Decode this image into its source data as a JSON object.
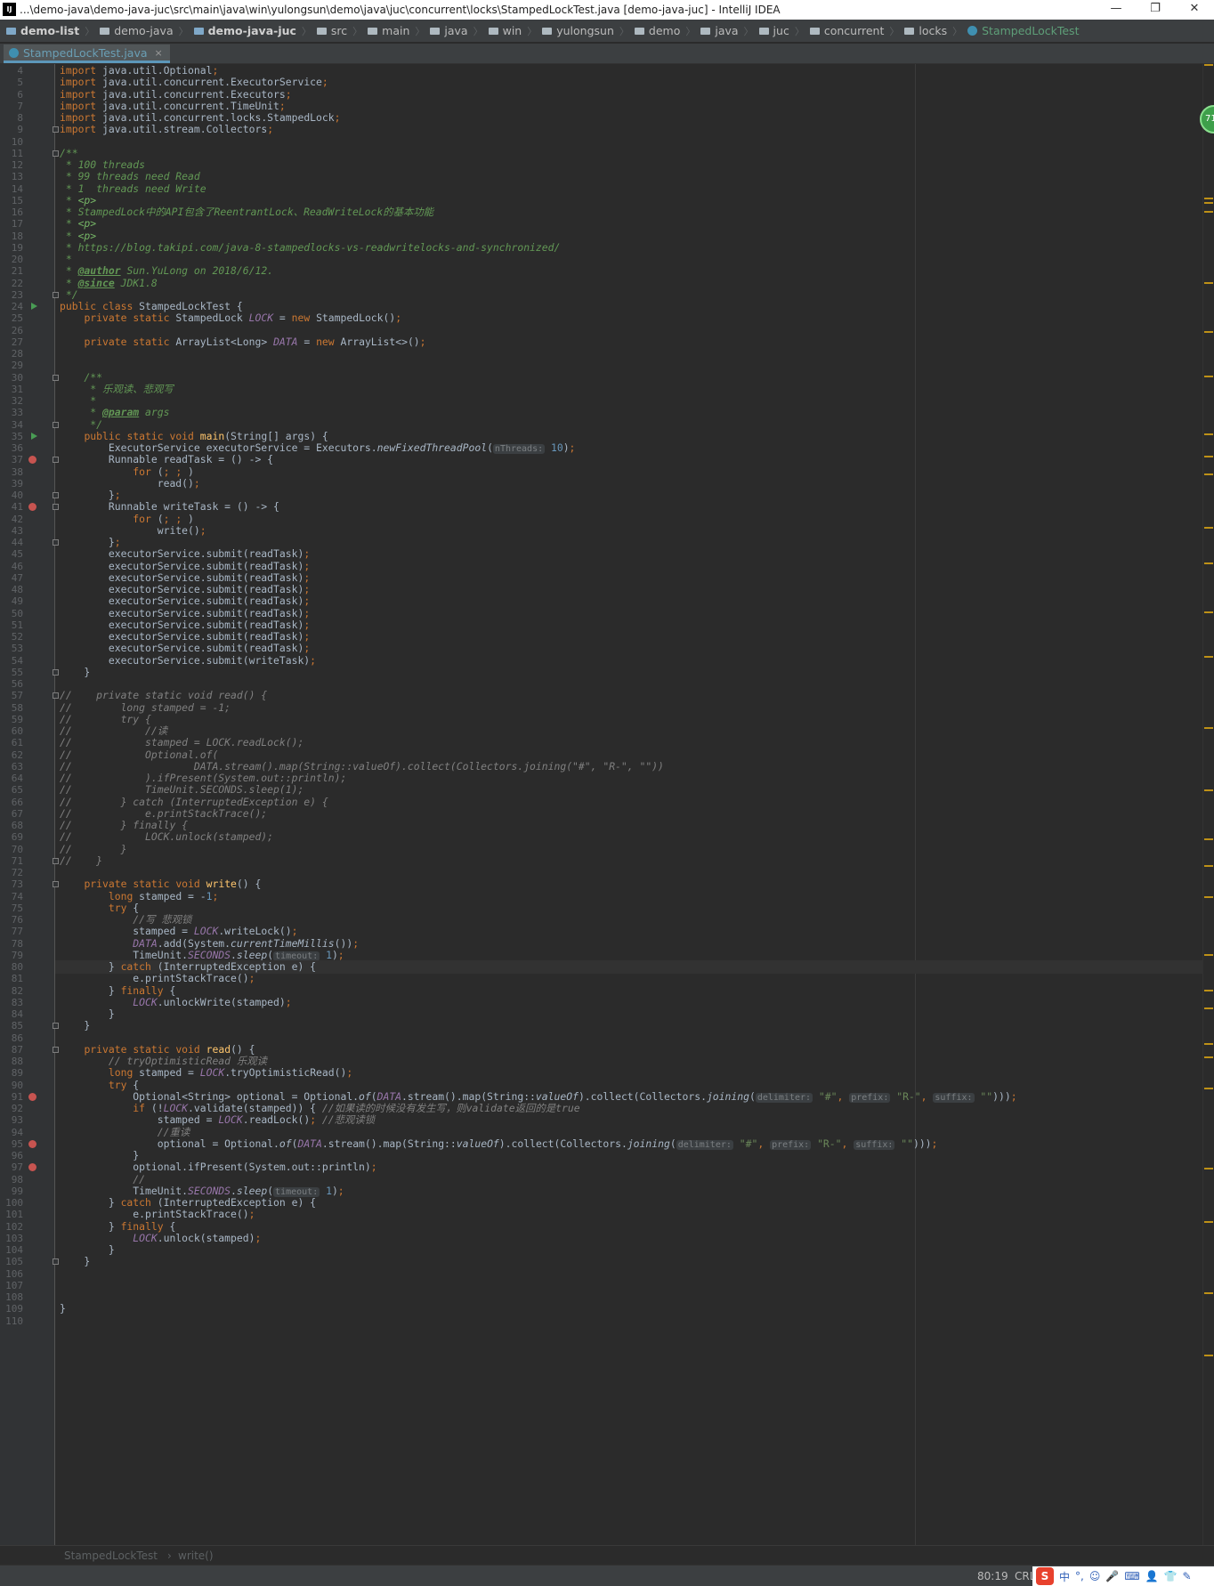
{
  "window": {
    "title": "...\\demo-java\\demo-java-juc\\src\\main\\java\\win\\yulongsun\\demo\\java\\juc\\concurrent\\locks\\StampedLockTest.java [demo-java-juc] - IntelliJ IDEA",
    "logo": "IJ",
    "minimize": "—",
    "restore": "❐",
    "close": "✕"
  },
  "breadcrumbs": [
    {
      "label": "demo-list",
      "bold": true,
      "icon": "module-folder-icon"
    },
    {
      "label": "demo-java",
      "icon": "folder-icon"
    },
    {
      "label": "demo-java-juc",
      "bold": true,
      "icon": "module-folder-icon"
    },
    {
      "label": "src",
      "icon": "folder-icon"
    },
    {
      "label": "main",
      "icon": "folder-icon"
    },
    {
      "label": "java",
      "icon": "folder-icon"
    },
    {
      "label": "win",
      "icon": "folder-icon"
    },
    {
      "label": "yulongsun",
      "icon": "folder-icon"
    },
    {
      "label": "demo",
      "icon": "folder-icon"
    },
    {
      "label": "java",
      "icon": "folder-icon"
    },
    {
      "label": "juc",
      "icon": "folder-icon"
    },
    {
      "label": "concurrent",
      "icon": "folder-icon"
    },
    {
      "label": "locks",
      "icon": "folder-icon"
    },
    {
      "label": "StampedLockTest",
      "cls": true,
      "icon": "class-icon"
    }
  ],
  "tab": {
    "label": "StampedLockTest.java",
    "close": "×"
  },
  "code_lines": [
    "import java.util.Optional;",
    "import java.util.concurrent.ExecutorService;",
    "import java.util.concurrent.Executors;",
    "import java.util.concurrent.TimeUnit;",
    "import java.util.concurrent.locks.StampedLock;",
    "import java.util.stream.Collectors;",
    "",
    "/**",
    " * 100 threads",
    " * 99 threads need Read",
    " * 1  threads need Write",
    " * <p>",
    " * StampedLock中的API包含了ReentrantLock、ReadWriteLock的基本功能",
    " * <p>",
    " * <p>",
    " * https://blog.takipi.com/java-8-stampedlocks-vs-readwritelocks-and-synchronized/",
    " *",
    " * @author Sun.YuLong on 2018/6/12.",
    " * @since JDK1.8",
    " */",
    "public class StampedLockTest {",
    "    private static StampedLock LOCK = new StampedLock();",
    "",
    "    private static ArrayList<Long> DATA = new ArrayList<>();",
    "",
    "",
    "    /**",
    "     * 乐观读、悲观写",
    "     *",
    "     * @param args",
    "     */",
    "    public static void main(String[] args) {",
    "        ExecutorService executorService = Executors.newFixedThreadPool(nThreads: 10);",
    "        Runnable readTask = () -> {",
    "            for (; ; )",
    "                read();",
    "        };",
    "        Runnable writeTask = () -> {",
    "            for (; ; )",
    "                write();",
    "        };",
    "        executorService.submit(readTask);",
    "        executorService.submit(readTask);",
    "        executorService.submit(readTask);",
    "        executorService.submit(readTask);",
    "        executorService.submit(readTask);",
    "        executorService.submit(readTask);",
    "        executorService.submit(readTask);",
    "        executorService.submit(readTask);",
    "        executorService.submit(readTask);",
    "        executorService.submit(writeTask);",
    "    }",
    "",
    "//    private static void read() {",
    "//        long stamped = -1;",
    "//        try {",
    "//            //读",
    "//            stamped = LOCK.readLock();",
    "//            Optional.of(",
    "//                    DATA.stream().map(String::valueOf).collect(Collectors.joining(\"#\", \"R-\", \"\"))",
    "//            ).ifPresent(System.out::println);",
    "//            TimeUnit.SECONDS.sleep(1);",
    "//        } catch (InterruptedException e) {",
    "//            e.printStackTrace();",
    "//        } finally {",
    "//            LOCK.unlock(stamped);",
    "//        }",
    "//    }",
    "",
    "    private static void write() {",
    "        long stamped = -1;",
    "        try {",
    "            //写 悲观锁",
    "            stamped = LOCK.writeLock();",
    "            DATA.add(System.currentTimeMillis());",
    "            TimeUnit.SECONDS.sleep(timeout: 1);",
    "        } catch (InterruptedException e) {",
    "            e.printStackTrace();",
    "        } finally {",
    "            LOCK.unlockWrite(stamped);",
    "        }",
    "    }",
    "",
    "    private static void read() {",
    "        // tryOptimisticRead 乐观读",
    "        long stamped = LOCK.tryOptimisticRead();",
    "        try {",
    "            Optional<String> optional = Optional.of(DATA.stream().map(String::valueOf).collect(Collectors.joining(delimiter: \"#\", prefix: \"R-\", suffix: \"\")));",
    "            if (!LOCK.validate(stamped)) { //如果读的时候没有发生写，则validate返回的是true",
    "                stamped = LOCK.readLock(); //悲观读锁",
    "                //重读",
    "                optional = Optional.of(DATA.stream().map(String::valueOf).collect(Collectors.joining(delimiter: \"#\", prefix: \"R-\", suffix: \"\")));",
    "            }",
    "            optional.ifPresent(System.out::println);",
    "            //",
    "            TimeUnit.SECONDS.sleep(timeout: 1);",
    "        } catch (InterruptedException e) {",
    "            e.printStackTrace();",
    "        } finally {",
    "            LOCK.unlock(stamped);",
    "        }",
    "    }",
    "",
    "",
    "",
    "}",
    ""
  ],
  "first_line_number": 4,
  "current_line_number": 80,
  "run_gutter_lines": [
    24,
    35
  ],
  "lambda_gutter_lines": [
    37,
    41,
    91,
    95,
    97
  ],
  "fold_lines": [
    9,
    11,
    23,
    30,
    34,
    37,
    40,
    41,
    44,
    55,
    57,
    71,
    73,
    85,
    87,
    105
  ],
  "breadcrumb_footer": {
    "class": "StampedLockTest",
    "separator": "›",
    "method": "write()"
  },
  "status": {
    "position": "80:19",
    "line_ending": "CRLF",
    "ime_label": "中",
    "ime_punct": "°,"
  },
  "colors": {
    "background": "#2b2b2b",
    "keyword": "#cc7832",
    "string": "#6a8759",
    "comment": "#808080",
    "doc": "#629755",
    "field": "#9876aa",
    "number": "#6897bb",
    "method": "#ffc66d"
  }
}
